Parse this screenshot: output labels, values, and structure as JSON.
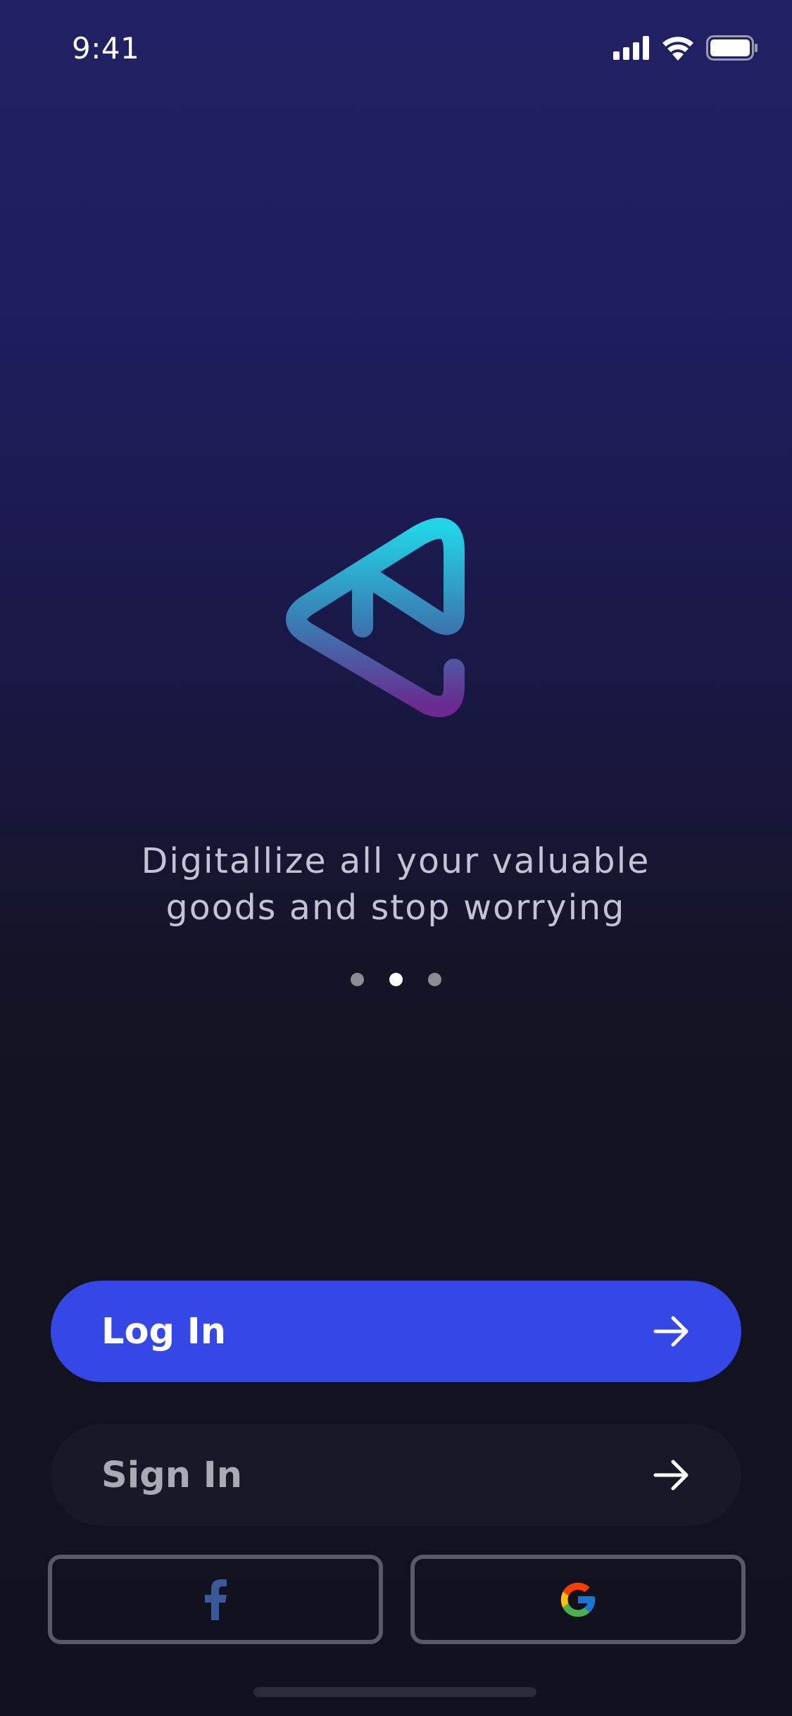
{
  "status_bar": {
    "time": "9:41",
    "icons": [
      "cellular-signal-icon",
      "wifi-icon",
      "battery-icon"
    ]
  },
  "logo": {
    "icon": "app-logo-icon",
    "colors": {
      "top": "#22d3e6",
      "bottom": "#6a2a8f"
    }
  },
  "onboarding": {
    "tagline_line1": "Digitallize all your valuable",
    "tagline_line2": "goods and stop worrying",
    "pager": {
      "total": 3,
      "active_index": 1
    }
  },
  "actions": {
    "login_label": "Log In",
    "signin_label": "Sign In",
    "arrow_icon": "arrow-right-icon"
  },
  "social": {
    "facebook_icon": "facebook-icon",
    "google_icon": "google-icon"
  },
  "colors": {
    "accent": "#3547e5",
    "secondary_button": "#171828",
    "background_top": "#202064",
    "background_bottom": "#111120",
    "facebook": "#3b5998"
  }
}
